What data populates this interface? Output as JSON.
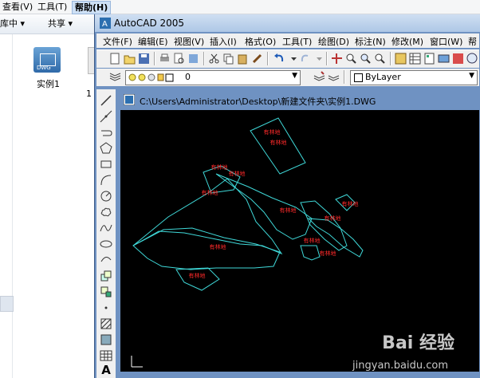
{
  "explorer": {
    "menu": [
      "查看(V)",
      "工具(T)",
      "帮助(H)"
    ],
    "toolbar": {
      "library": "库中 ▾",
      "share": "共享 ▾"
    },
    "file_label": "实例1",
    "file_count_fragment": "1"
  },
  "acad": {
    "title": "AutoCAD 2005",
    "menu": [
      "文件(F)",
      "编辑(E)",
      "视图(V)",
      "插入(I)",
      "格式(O)",
      "工具(T)",
      "绘图(D)",
      "标注(N)",
      "修改(M)",
      "窗口(W)",
      "帮"
    ],
    "layer_value": "0",
    "color_value": "ByLayer",
    "drawing_title": "C:\\Users\\Administrator\\Desktop\\新建文件夹\\实例1.DWG"
  },
  "labels": [
    "有林地",
    "有林地",
    "有林地",
    "有林地",
    "有林地",
    "有林地",
    "有林地",
    "有林地",
    "有林地",
    "有林地",
    "有林地",
    "有林地"
  ],
  "watermark": {
    "logo": "Bai 经验",
    "url": "jingyan.baidu.com"
  },
  "colors": {
    "canvas": "#000000",
    "polygon": "#3fd8d8",
    "label": "#ff2a2a",
    "window_frame": "#6f92c2"
  }
}
